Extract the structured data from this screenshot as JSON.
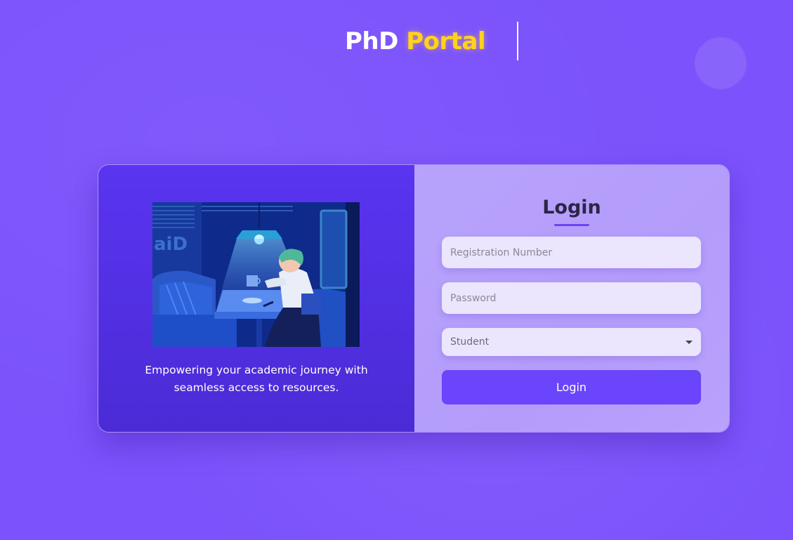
{
  "header": {
    "brand_primary": "PhD",
    "brand_accent": "Portal",
    "accent_color": "#ffd21f"
  },
  "left_panel": {
    "illustration": "person-drinking-coffee-night-diner-illustration",
    "tagline_line1": "Empowering your academic journey with",
    "tagline_line2": "seamless access to resources."
  },
  "login": {
    "title": "Login",
    "registration_placeholder": "Registration Number",
    "password_placeholder": "Password",
    "role_selected": "Student",
    "submit_label": "Login"
  },
  "colors": {
    "background": "#7b52fb",
    "left_panel": "#5a34f0",
    "right_panel": "#b7a3fb",
    "button": "#6a45fb",
    "input_bg": "#ebe5fd"
  }
}
